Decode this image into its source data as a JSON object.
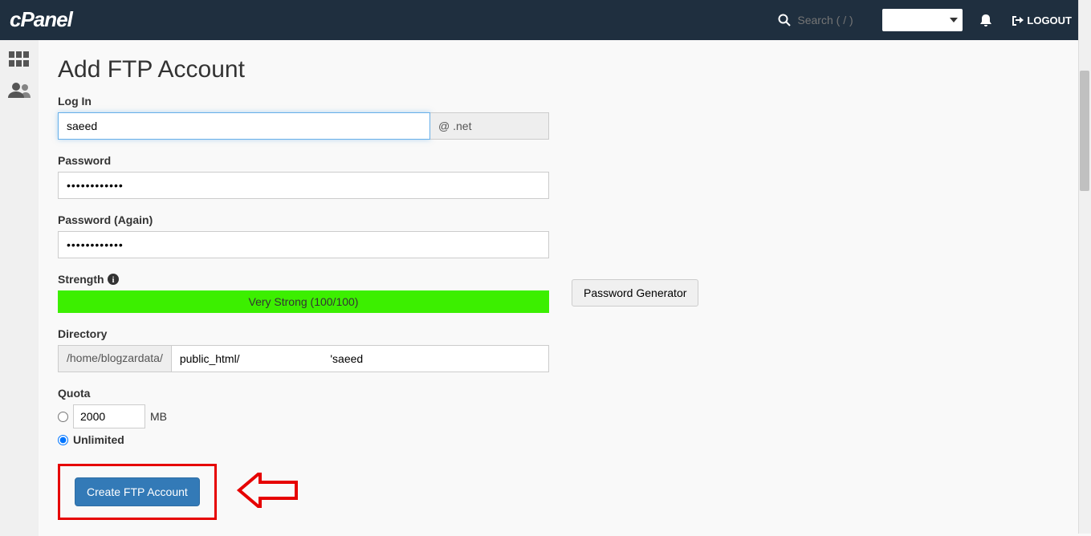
{
  "navbar": {
    "search_placeholder": "Search ( / )",
    "logout": "LOGOUT"
  },
  "page": {
    "title": "Add FTP Account"
  },
  "form": {
    "login_label": "Log In",
    "login_value": "saeed",
    "domain_addon": "@                    .net",
    "password_label": "Password",
    "password_value": "••••••••••••",
    "password_again_label": "Password (Again)",
    "password_again_value": "••••••••••••",
    "strength_label": "Strength",
    "strength_text": "Very Strong (100/100)",
    "gen_button": "Password Generator",
    "directory_label": "Directory",
    "directory_prefix": "/home/blogzardata/",
    "directory_value": "public_html/                             'saeed",
    "quota_label": "Quota",
    "quota_value": "2000",
    "quota_unit": "MB",
    "quota_unlimited": "Unlimited",
    "create_button": "Create FTP Account"
  }
}
